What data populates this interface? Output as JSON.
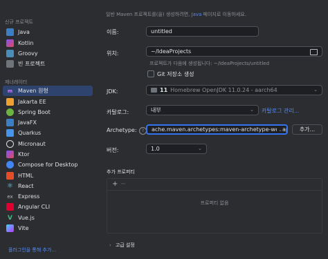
{
  "sidebar": {
    "new_project_title": "신규 프로젝트",
    "new_project_items": [
      {
        "label": "Java",
        "icon": "java-folder-icon"
      },
      {
        "label": "Kotlin",
        "icon": "kotlin-icon"
      },
      {
        "label": "Groovy",
        "icon": "groovy-icon"
      },
      {
        "label": "빈 프로젝트",
        "icon": "empty-project-icon"
      }
    ],
    "generators_title": "제너레이터",
    "generator_items": [
      {
        "label": "Maven 원형",
        "icon": "maven-icon",
        "selected": true
      },
      {
        "label": "Jakarta EE",
        "icon": "jakarta-icon"
      },
      {
        "label": "Spring Boot",
        "icon": "spring-icon"
      },
      {
        "label": "JavaFX",
        "icon": "javafx-icon"
      },
      {
        "label": "Quarkus",
        "icon": "quarkus-icon"
      },
      {
        "label": "Micronaut",
        "icon": "micronaut-icon"
      },
      {
        "label": "Ktor",
        "icon": "ktor-icon"
      },
      {
        "label": "Compose for Desktop",
        "icon": "compose-icon"
      },
      {
        "label": "HTML",
        "icon": "html-icon"
      },
      {
        "label": "React",
        "icon": "react-icon"
      },
      {
        "label": "Express",
        "icon": "express-icon"
      },
      {
        "label": "Angular CLI",
        "icon": "angular-icon"
      },
      {
        "label": "Vue.js",
        "icon": "vue-icon"
      },
      {
        "label": "Vite",
        "icon": "vite-icon"
      }
    ],
    "plugins_link": "플러그인을 통해 추가..."
  },
  "main": {
    "hint_prefix": "일반 Maven 프로젝트를(을) 생성하려면, ",
    "hint_link": "Java",
    "hint_suffix": " 페이지로 이동하세요.",
    "name_label": "이름:",
    "name_value": "untitled",
    "location_label": "위치:",
    "location_value": "~/IdeaProjects",
    "location_sub": "프로젝트가 다음에 생성됩니다: ~/IdeaProjects/untitled",
    "git_label": "Git 저장소 생성",
    "git_checked": false,
    "jdk_label": "JDK:",
    "jdk_version": "11",
    "jdk_detail": "Homebrew OpenJDK 11.0.24 - aarch64",
    "catalog_label": "카탈로그:",
    "catalog_value": "내부",
    "catalog_manage": "카탈로그 관리...",
    "archetype_label": "Archetype:",
    "archetype_value": "ache.maven.archetypes:maven-archetype-webapp",
    "add_button": "추가...",
    "version_label": "버전:",
    "version_value": "1.0",
    "props_title": "추가 프로퍼티",
    "props_add": "+",
    "props_remove": "−",
    "props_empty": "프로퍼티 없음",
    "advanced": "고급 설정"
  },
  "colors": {
    "accent": "#3574f0",
    "selected": "#2e436e",
    "link": "#548af7"
  }
}
